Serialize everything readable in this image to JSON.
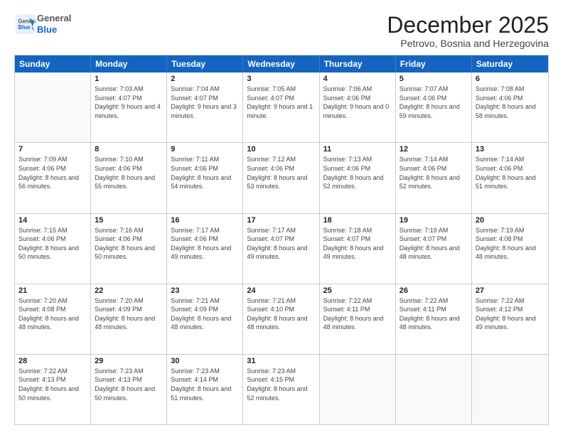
{
  "logo": {
    "general": "General",
    "blue": "Blue"
  },
  "title": "December 2025",
  "subtitle": "Petrovo, Bosnia and Herzegovina",
  "days": [
    "Sunday",
    "Monday",
    "Tuesday",
    "Wednesday",
    "Thursday",
    "Friday",
    "Saturday"
  ],
  "weeks": [
    [
      {
        "day": "",
        "empty": true
      },
      {
        "day": "1",
        "sunrise": "7:03 AM",
        "sunset": "4:07 PM",
        "daylight": "9 hours and 4 minutes."
      },
      {
        "day": "2",
        "sunrise": "7:04 AM",
        "sunset": "4:07 PM",
        "daylight": "9 hours and 3 minutes."
      },
      {
        "day": "3",
        "sunrise": "7:05 AM",
        "sunset": "4:07 PM",
        "daylight": "9 hours and 1 minute."
      },
      {
        "day": "4",
        "sunrise": "7:06 AM",
        "sunset": "4:06 PM",
        "daylight": "9 hours and 0 minutes."
      },
      {
        "day": "5",
        "sunrise": "7:07 AM",
        "sunset": "4:06 PM",
        "daylight": "8 hours and 59 minutes."
      },
      {
        "day": "6",
        "sunrise": "7:08 AM",
        "sunset": "4:06 PM",
        "daylight": "8 hours and 58 minutes."
      }
    ],
    [
      {
        "day": "7",
        "sunrise": "7:09 AM",
        "sunset": "4:06 PM",
        "daylight": "8 hours and 56 minutes."
      },
      {
        "day": "8",
        "sunrise": "7:10 AM",
        "sunset": "4:06 PM",
        "daylight": "8 hours and 55 minutes."
      },
      {
        "day": "9",
        "sunrise": "7:11 AM",
        "sunset": "4:06 PM",
        "daylight": "8 hours and 54 minutes."
      },
      {
        "day": "10",
        "sunrise": "7:12 AM",
        "sunset": "4:06 PM",
        "daylight": "8 hours and 53 minutes."
      },
      {
        "day": "11",
        "sunrise": "7:13 AM",
        "sunset": "4:06 PM",
        "daylight": "8 hours and 52 minutes."
      },
      {
        "day": "12",
        "sunrise": "7:14 AM",
        "sunset": "4:06 PM",
        "daylight": "8 hours and 52 minutes."
      },
      {
        "day": "13",
        "sunrise": "7:14 AM",
        "sunset": "4:06 PM",
        "daylight": "8 hours and 51 minutes."
      }
    ],
    [
      {
        "day": "14",
        "sunrise": "7:15 AM",
        "sunset": "4:06 PM",
        "daylight": "8 hours and 50 minutes."
      },
      {
        "day": "15",
        "sunrise": "7:16 AM",
        "sunset": "4:06 PM",
        "daylight": "8 hours and 50 minutes."
      },
      {
        "day": "16",
        "sunrise": "7:17 AM",
        "sunset": "4:06 PM",
        "daylight": "8 hours and 49 minutes."
      },
      {
        "day": "17",
        "sunrise": "7:17 AM",
        "sunset": "4:07 PM",
        "daylight": "8 hours and 49 minutes."
      },
      {
        "day": "18",
        "sunrise": "7:18 AM",
        "sunset": "4:07 PM",
        "daylight": "8 hours and 49 minutes."
      },
      {
        "day": "19",
        "sunrise": "7:19 AM",
        "sunset": "4:07 PM",
        "daylight": "8 hours and 48 minutes."
      },
      {
        "day": "20",
        "sunrise": "7:19 AM",
        "sunset": "4:08 PM",
        "daylight": "8 hours and 48 minutes."
      }
    ],
    [
      {
        "day": "21",
        "sunrise": "7:20 AM",
        "sunset": "4:08 PM",
        "daylight": "8 hours and 48 minutes."
      },
      {
        "day": "22",
        "sunrise": "7:20 AM",
        "sunset": "4:09 PM",
        "daylight": "8 hours and 48 minutes."
      },
      {
        "day": "23",
        "sunrise": "7:21 AM",
        "sunset": "4:09 PM",
        "daylight": "8 hours and 48 minutes."
      },
      {
        "day": "24",
        "sunrise": "7:21 AM",
        "sunset": "4:10 PM",
        "daylight": "8 hours and 48 minutes."
      },
      {
        "day": "25",
        "sunrise": "7:22 AM",
        "sunset": "4:11 PM",
        "daylight": "8 hours and 48 minutes."
      },
      {
        "day": "26",
        "sunrise": "7:22 AM",
        "sunset": "4:11 PM",
        "daylight": "8 hours and 48 minutes."
      },
      {
        "day": "27",
        "sunrise": "7:22 AM",
        "sunset": "4:12 PM",
        "daylight": "8 hours and 49 minutes."
      }
    ],
    [
      {
        "day": "28",
        "sunrise": "7:22 AM",
        "sunset": "4:13 PM",
        "daylight": "8 hours and 50 minutes."
      },
      {
        "day": "29",
        "sunrise": "7:23 AM",
        "sunset": "4:13 PM",
        "daylight": "8 hours and 50 minutes."
      },
      {
        "day": "30",
        "sunrise": "7:23 AM",
        "sunset": "4:14 PM",
        "daylight": "8 hours and 51 minutes."
      },
      {
        "day": "31",
        "sunrise": "7:23 AM",
        "sunset": "4:15 PM",
        "daylight": "8 hours and 52 minutes."
      },
      {
        "day": "",
        "empty": true
      },
      {
        "day": "",
        "empty": true
      },
      {
        "day": "",
        "empty": true
      }
    ]
  ]
}
